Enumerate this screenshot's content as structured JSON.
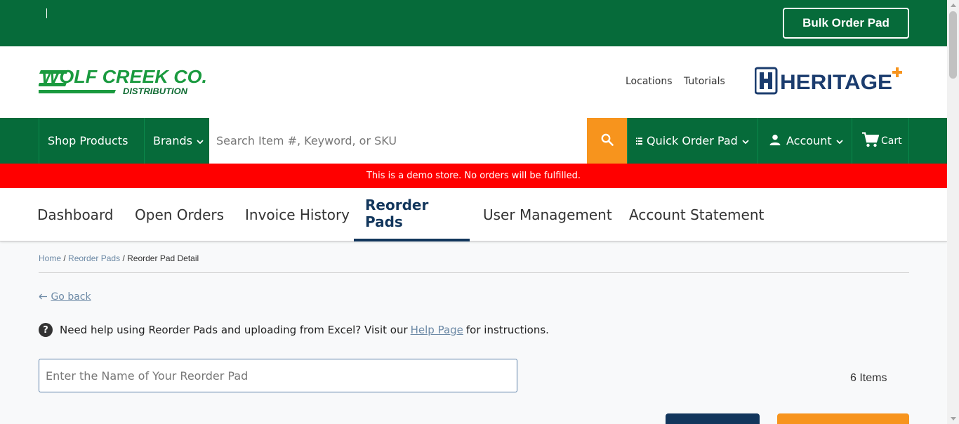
{
  "topbar": {
    "bulk_order_label": "Bulk Order Pad"
  },
  "header": {
    "logo_main": "WOLF CREEK CO.",
    "logo_sub": "DISTRIBUTION",
    "links": [
      "Locations",
      "Tutorials"
    ],
    "partner_logo": "HERITAGE"
  },
  "navbar": {
    "shop_products": "Shop Products",
    "brands": "Brands",
    "search_placeholder": "Search Item #, Keyword, or SKU",
    "quick_order_pad": "Quick Order Pad",
    "account": "Account",
    "cart": "Cart"
  },
  "banner": {
    "text": "This is a demo store. No orders will be fulfilled."
  },
  "tabs": [
    {
      "label": "Dashboard"
    },
    {
      "label": "Open Orders"
    },
    {
      "label": "Invoice History"
    },
    {
      "label": "Reorder Pads",
      "active": true
    },
    {
      "label": "User Management"
    },
    {
      "label": "Account Statement"
    }
  ],
  "breadcrumb": {
    "home": "Home",
    "reorder_pads": "Reorder Pads",
    "current": "Reorder Pad Detail",
    "sep": "/"
  },
  "go_back": "Go back",
  "help": {
    "prefix": "Need help using Reorder Pads and uploading from Excel? Visit our",
    "link": "Help Page",
    "suffix": "for instructions."
  },
  "pad_name": {
    "placeholder": "Enter the Name of Your Reorder Pad",
    "value": ""
  },
  "items_count": "6 Items",
  "colors": {
    "brand_green": "#066b3a",
    "accent_orange": "#f7941d",
    "navy": "#12365c",
    "banner_red": "#ff0000"
  }
}
